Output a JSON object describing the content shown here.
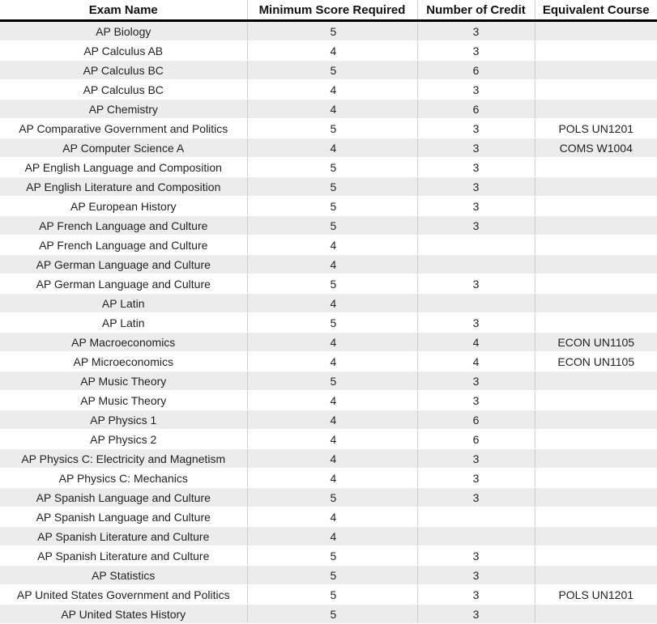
{
  "headers": [
    "Exam Name",
    "Minimum Score Required",
    "Number of Credit",
    "Equivalent Course"
  ],
  "rows": [
    {
      "exam": "AP Biology",
      "score": "5",
      "credit": "3",
      "course": ""
    },
    {
      "exam": "AP Calculus AB",
      "score": "4",
      "credit": "3",
      "course": ""
    },
    {
      "exam": "AP Calculus BC",
      "score": "5",
      "credit": "6",
      "course": ""
    },
    {
      "exam": "AP Calculus BC",
      "score": "4",
      "credit": "3",
      "course": ""
    },
    {
      "exam": "AP Chemistry",
      "score": "4",
      "credit": "6",
      "course": ""
    },
    {
      "exam": "AP Comparative Government and Politics",
      "score": "5",
      "credit": "3",
      "course": "POLS UN1201"
    },
    {
      "exam": "AP Computer Science A",
      "score": "4",
      "credit": "3",
      "course": "COMS W1004"
    },
    {
      "exam": "AP English Language and Composition",
      "score": "5",
      "credit": "3",
      "course": ""
    },
    {
      "exam": "AP English Literature and Composition",
      "score": "5",
      "credit": "3",
      "course": ""
    },
    {
      "exam": "AP European History",
      "score": "5",
      "credit": "3",
      "course": ""
    },
    {
      "exam": "AP French Language and Culture",
      "score": "5",
      "credit": "3",
      "course": ""
    },
    {
      "exam": "AP French Language and Culture",
      "score": "4",
      "credit": "",
      "course": ""
    },
    {
      "exam": "AP German Language and Culture",
      "score": "4",
      "credit": "",
      "course": ""
    },
    {
      "exam": "AP German Language and Culture",
      "score": "5",
      "credit": "3",
      "course": ""
    },
    {
      "exam": "AP Latin",
      "score": "4",
      "credit": "",
      "course": ""
    },
    {
      "exam": "AP Latin",
      "score": "5",
      "credit": "3",
      "course": ""
    },
    {
      "exam": "AP Macroeconomics",
      "score": "4",
      "credit": "4",
      "course": "ECON UN1105"
    },
    {
      "exam": "AP Microeconomics",
      "score": "4",
      "credit": "4",
      "course": "ECON UN1105"
    },
    {
      "exam": "AP Music Theory",
      "score": "5",
      "credit": "3",
      "course": ""
    },
    {
      "exam": "AP Music Theory",
      "score": "4",
      "credit": "3",
      "course": ""
    },
    {
      "exam": "AP Physics 1",
      "score": "4",
      "credit": "6",
      "course": ""
    },
    {
      "exam": "AP Physics 2",
      "score": "4",
      "credit": "6",
      "course": ""
    },
    {
      "exam": "AP Physics C: Electricity and Magnetism",
      "score": "4",
      "credit": "3",
      "course": ""
    },
    {
      "exam": "AP Physics C: Mechanics",
      "score": "4",
      "credit": "3",
      "course": ""
    },
    {
      "exam": "AP Spanish Language and Culture",
      "score": "5",
      "credit": "3",
      "course": ""
    },
    {
      "exam": "AP Spanish Language and Culture",
      "score": "4",
      "credit": "",
      "course": ""
    },
    {
      "exam": "AP Spanish Literature and Culture",
      "score": "4",
      "credit": "",
      "course": ""
    },
    {
      "exam": "AP Spanish Literature and Culture",
      "score": "5",
      "credit": "3",
      "course": ""
    },
    {
      "exam": "AP Statistics",
      "score": "5",
      "credit": "3",
      "course": ""
    },
    {
      "exam": "AP United States Government and Politics",
      "score": "5",
      "credit": "3",
      "course": "POLS UN1201"
    },
    {
      "exam": "AP United States History",
      "score": "5",
      "credit": "3",
      "course": ""
    }
  ]
}
